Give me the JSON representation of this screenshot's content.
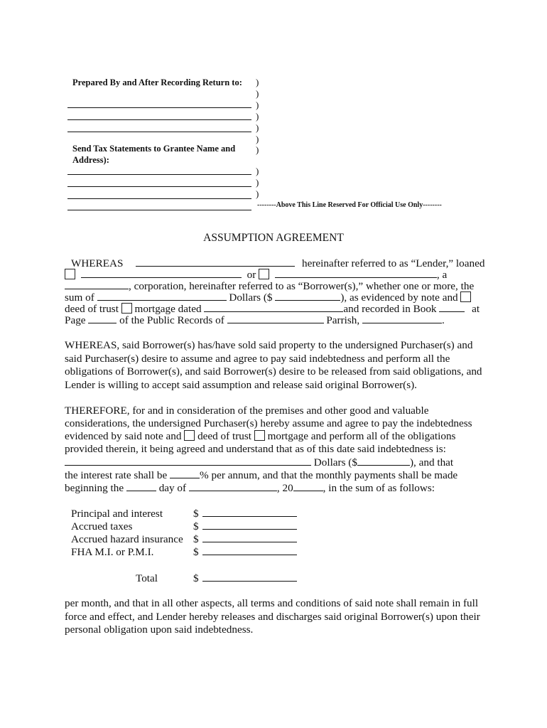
{
  "header": {
    "prepared_by_label": "Prepared By and After Recording Return to:",
    "send_tax_label_line1": "Send Tax Statements to Grantee Name and",
    "send_tax_label_line2": "Address):",
    "paren": ")",
    "official_use": "--------Above This Line Reserved For Official Use Only--------"
  },
  "title": "ASSUMPTION AGREEMENT",
  "whereas1": {
    "l1_a": "WHEREAS",
    "l1_b": "hereinafter referred to as “Lender,” loaned",
    "l2_or": "or",
    "l2_a": ", a",
    "l3": ", corporation, hereinafter referred to as “Borrower(s),” whether one or more, the",
    "l4_a": "sum of",
    "l4_b": "Dollars ($",
    "l4_c": "), as evidenced by note and",
    "l5_a": "deed of trust",
    "l5_b": "mortgage dated",
    "l5_c": "and recorded in Book",
    "l5_d": "at",
    "l6_a": "Page",
    "l6_b": "of the Public Records of",
    "l6_c": "Parrish,",
    "l6_d": "."
  },
  "whereas2": "WHEREAS, said Borrower(s) has/have sold said property to the undersigned Purchaser(s) and said Purchaser(s) desire to assume and agree to pay said indebtedness and perform all the obligations of Borrower(s), and said Borrower(s) desire to be released from said obligations, and Lender is willing to accept said assumption and release said original Borrower(s).",
  "therefore": {
    "l1": "THEREFORE, for and in consideration of the premises and other good and valuable",
    "l2": "considerations, the undersigned Purchaser(s) hereby assume and agree to pay the indebtedness",
    "l3_a": "evidenced by said note and",
    "l3_b": "deed of trust",
    "l3_c": "mortgage and perform all of the obligations",
    "l4": "provided therein, it being agreed and understand that as of this date said indebtedness is:",
    "l5_a": "Dollars ($",
    "l5_b": "), and that",
    "l6_a": "the interest rate shall be",
    "l6_b": "% per annum, and that the monthly payments shall be made",
    "l7_a": "beginning the",
    "l7_b": "day of",
    "l7_c": ", 20",
    "l7_d": ", in the sum of as follows:"
  },
  "payments": [
    {
      "label": "Principal and interest",
      "currency": "$",
      "value": ""
    },
    {
      "label": "Accrued taxes",
      "currency": "$",
      "value": ""
    },
    {
      "label": "Accrued hazard insurance",
      "currency": "$",
      "value": ""
    },
    {
      "label": "FHA M.I. or P.M.I.",
      "currency": "$",
      "value": ""
    }
  ],
  "total": {
    "label": "Total",
    "currency": "$",
    "value": ""
  },
  "closing": "per month, and that in all other aspects, all terms and conditions of said note shall remain in full force and effect, and Lender hereby releases and discharges said original Borrower(s) upon their personal obligation upon said indebtedness."
}
